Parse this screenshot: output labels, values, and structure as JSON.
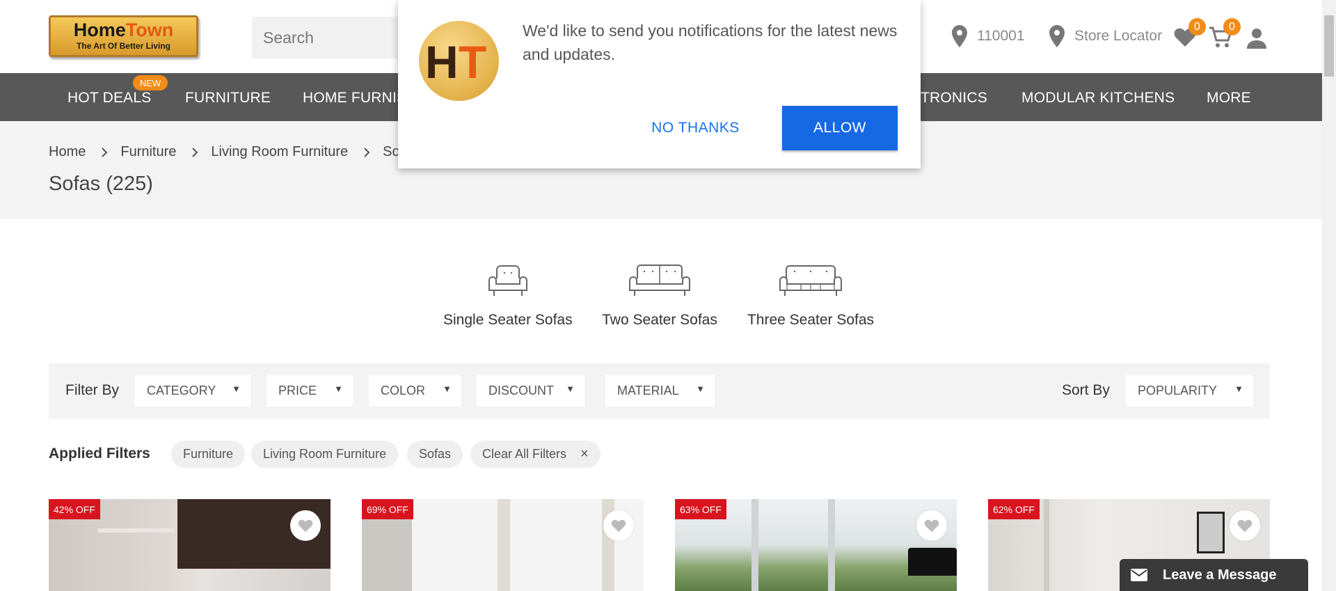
{
  "header": {
    "logo_main_1": "Home",
    "logo_main_2": "Town",
    "logo_tagline": "The Art Of Better Living",
    "search_placeholder": "Search",
    "pincode": "110001",
    "store_locator": "Store Locator",
    "wishlist_count": "0",
    "cart_count": "0"
  },
  "nav": {
    "new_badge": "NEW",
    "items": [
      "HOT DEALS",
      "FURNITURE",
      "HOME FURNISHINGS",
      "ELECTRONICS",
      "MODULAR KITCHENS",
      "MORE"
    ],
    "visible": [
      "HOT DEALS",
      "FURNITURE",
      "HOME FURNIS",
      "TRONICS",
      "MODULAR KITCHENS",
      "MORE"
    ]
  },
  "breadcrumb": [
    "Home",
    "Furniture",
    "Living Room Furniture",
    "So"
  ],
  "page_title": "Sofas (225)",
  "categories": [
    {
      "label": "Single Seater Sofas",
      "icon": "single-seater-sofa-icon"
    },
    {
      "label": "Two Seater Sofas",
      "icon": "two-seater-sofa-icon"
    },
    {
      "label": "Three Seater Sofas",
      "icon": "three-seater-sofa-icon"
    }
  ],
  "filters": {
    "filter_by_label": "Filter By",
    "dropdowns": [
      "CATEGORY",
      "PRICE",
      "COLOR",
      "DISCOUNT",
      "MATERIAL"
    ],
    "sort_by_label": "Sort By",
    "sort_value": "POPULARITY",
    "caret": "▼"
  },
  "applied_filters": {
    "label": "Applied Filters",
    "chips": [
      "Furniture",
      "Living Room Furniture",
      "Sofas"
    ],
    "clear_all": "Clear All Filters",
    "clear_icon": "×"
  },
  "products": [
    {
      "discount": "42% OFF"
    },
    {
      "discount": "69% OFF"
    },
    {
      "discount": "63% OFF"
    },
    {
      "discount": "62% OFF"
    }
  ],
  "popup": {
    "logo_h": "H",
    "logo_t": "T",
    "message": "We'd like to send you notifications for the latest news and updates.",
    "no_thanks": "NO THANKS",
    "allow": "ALLOW"
  },
  "chat": {
    "label": "Leave a Message"
  },
  "colors": {
    "nav_bg": "#585858",
    "accent_orange": "#f28c18",
    "discount_red": "#d8141f",
    "allow_blue": "#1668e3"
  }
}
